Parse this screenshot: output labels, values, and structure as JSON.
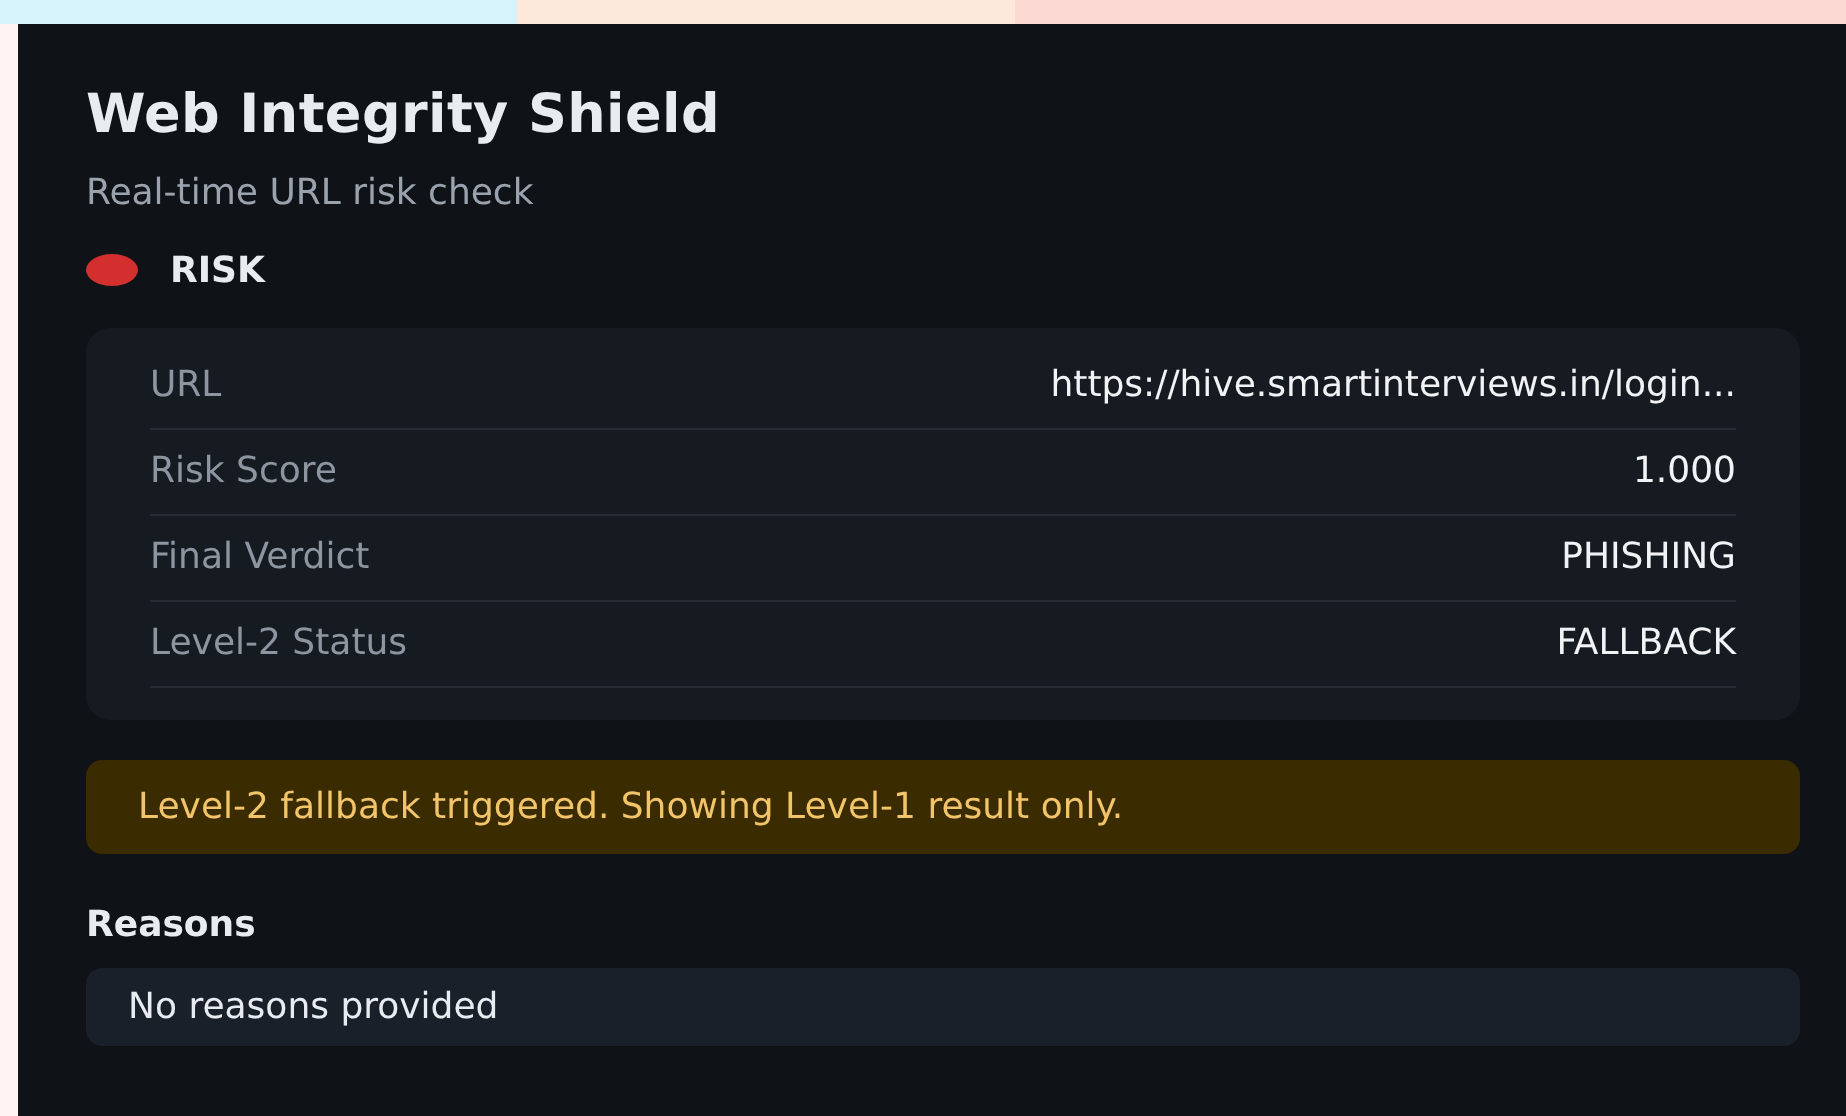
{
  "title": "Web Integrity Shield",
  "subtitle": "Real-time URL risk check",
  "status": {
    "label": "RISK",
    "kind": "risk"
  },
  "details": [
    {
      "label": "URL",
      "value": "https://hive.smartinterviews.in/login..."
    },
    {
      "label": "Risk Score",
      "value": "1.000"
    },
    {
      "label": "Final Verdict",
      "value": "PHISHING"
    },
    {
      "label": "Level-2 Status",
      "value": "FALLBACK"
    }
  ],
  "alert": {
    "kind": "warning",
    "text": "Level-2 fallback triggered. Showing Level-1 result only."
  },
  "reasons": {
    "heading": "Reasons",
    "items": [
      "No reasons provided"
    ]
  }
}
